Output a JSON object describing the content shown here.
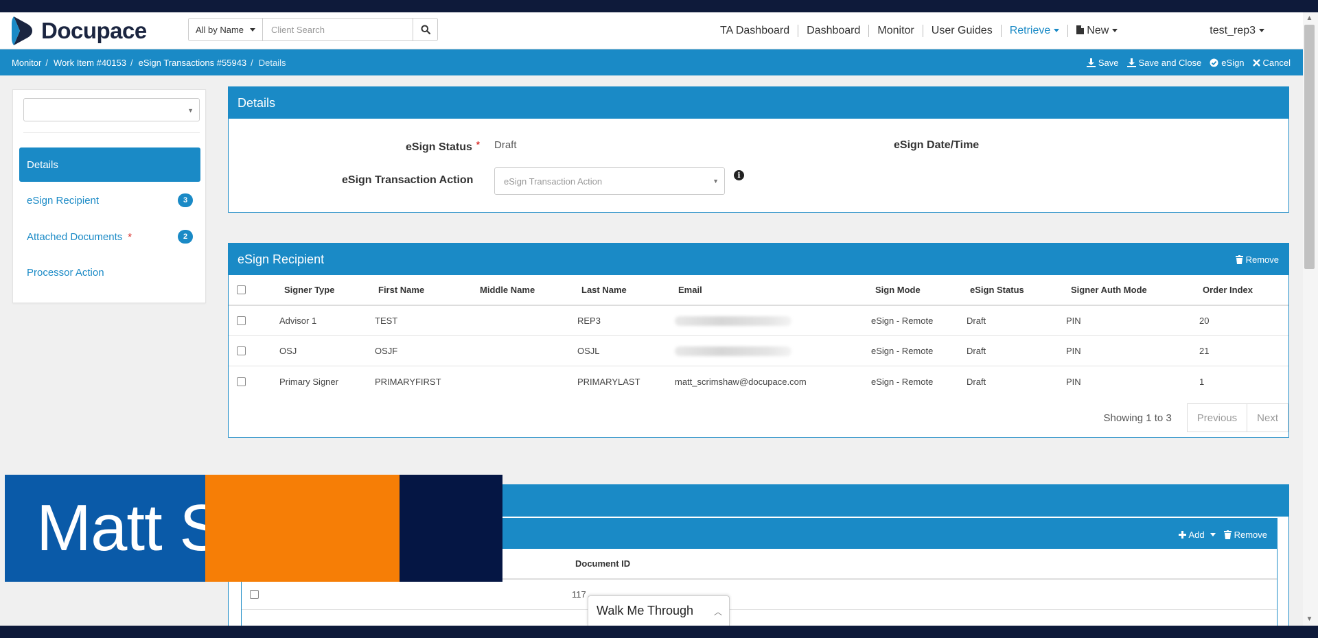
{
  "header": {
    "brand": "Docupace",
    "search_mode": "All by Name",
    "search_placeholder": "Client Search",
    "nav": [
      "TA Dashboard",
      "Dashboard",
      "Monitor",
      "User Guides"
    ],
    "retrieve_label": "Retrieve",
    "new_label": "New",
    "user": "test_rep3"
  },
  "breadcrumb": {
    "items": [
      "Monitor",
      "Work Item #40153",
      "eSign Transactions #55943"
    ],
    "current": "Details",
    "actions": {
      "save": "Save",
      "save_close": "Save and Close",
      "esign": "eSign",
      "cancel": "Cancel"
    }
  },
  "sidebar": {
    "items": [
      {
        "label": "Details",
        "active": true
      },
      {
        "label": "eSign Recipient",
        "badge": "3"
      },
      {
        "label": "Attached Documents",
        "required": "*",
        "badge": "2"
      },
      {
        "label": "Processor Action"
      }
    ]
  },
  "details": {
    "title": "Details",
    "status_label": "eSign Status",
    "required_mark": "*",
    "status_value": "Draft",
    "datetime_label": "eSign Date/Time",
    "action_label": "eSign Transaction Action",
    "action_placeholder": "eSign Transaction Action"
  },
  "recipient": {
    "title": "eSign Recipient",
    "remove_label": "Remove",
    "columns": [
      "Signer Type",
      "First Name",
      "Middle Name",
      "Last Name",
      "Email",
      "Sign Mode",
      "eSign Status",
      "Signer Auth Mode",
      "Order Index"
    ],
    "rows": [
      {
        "signer_type": "Advisor 1",
        "first": "TEST",
        "middle": "",
        "last": "REP3",
        "email": "",
        "mode": "eSign - Remote",
        "status": "Draft",
        "auth": "PIN",
        "order": "20"
      },
      {
        "signer_type": "OSJ",
        "first": "OSJF",
        "middle": "",
        "last": "OSJL",
        "email": "",
        "mode": "eSign - Remote",
        "status": "Draft",
        "auth": "PIN",
        "order": "21"
      },
      {
        "signer_type": "Primary Signer",
        "first": "PRIMARYFIRST",
        "middle": "",
        "last": "PRIMARYLAST",
        "email": "matt_scrimshaw@docupace.com",
        "mode": "eSign - Remote",
        "status": "Draft",
        "auth": "PIN",
        "order": "1"
      }
    ],
    "showing": "Showing 1 to 3",
    "previous": "Previous",
    "next": "Next"
  },
  "documents": {
    "add_label": "Add",
    "remove_label": "Remove",
    "column_doc_id": "Document ID",
    "row_doc_id": "117"
  },
  "overlay": {
    "name_text": "Matt S",
    "colors": {
      "blue": "#0a5aa8",
      "orange": "#f67e06",
      "navy": "#051644"
    }
  },
  "walkme": {
    "label": "Walk Me Through"
  },
  "colors": {
    "accent": "#1a8ac6",
    "brand_dark": "#1b2540",
    "required": "#d9302c"
  }
}
